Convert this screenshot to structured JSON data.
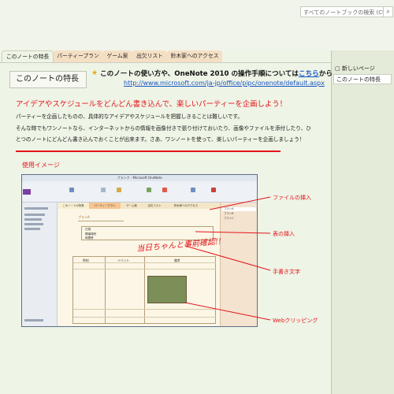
{
  "search": {
    "placeholder": "すべてのノートブックの検索 (Ctrl+E",
    "icon": "search-icon"
  },
  "tabs": [
    {
      "label": "このノートの特長",
      "color": "#eef4e6",
      "active": true
    },
    {
      "label": "パーティープラン",
      "color": "#f5dfc4"
    },
    {
      "label": "ゲーム案",
      "color": "#f5dfc4"
    },
    {
      "label": "出欠リスト",
      "color": "#f5dfc4"
    },
    {
      "label": "鈴木家へのアクセス",
      "color": "#f5dfc4"
    }
  ],
  "side_panel": {
    "new_page": "新しいページ",
    "pages": [
      "このノートの特長"
    ]
  },
  "page": {
    "title": "このノートの特長",
    "headline_before": "このノートの使い方や、OneNote 2010 の操作手順については",
    "headline_link": "こちら",
    "headline_after": "から",
    "url": "http://www.microsoft.com/ja-jp/office/pipc/onenote/default.aspx",
    "catchphrase": "アイデアやスケジュールをどんどん書き込んで、楽しいパーティーを企画しよう！",
    "paragraph_1": "パーティーを企画したものの、具体的なアイデアやスケジュールを把握しきることは難しいです。",
    "paragraph_2": "そんな時でもワンノートなら、インターネットからの情報を画像付きで張り付けておいたり、画像やファイルを添付したり、ひ",
    "paragraph_3": "とつのノートにどんどん書き込んでおくことが出来ます。さあ、ワンノートを使って、楽しいパーティーを企画しましょう！",
    "usage_heading": "使用イメージ"
  },
  "screenshot": {
    "window_title": "ブランク - Microsoft OneNote",
    "tabs": [
      "このノートの特長",
      "パーティープラン",
      "ゲーム案",
      "出欠リスト",
      "鈴木家へのアクセス"
    ],
    "pages": [
      "プランA",
      "プランB",
      "プランC"
    ],
    "page_title": "プランA",
    "row_labels": [
      "日程",
      "開催場所",
      "時間帯"
    ],
    "grid_headers": [
      "時刻",
      "イベント",
      "備考"
    ],
    "handwriting": "当日ちゃんと事前確認!!"
  },
  "callouts": [
    "ファイルの挿入",
    "表の挿入",
    "手書き文字",
    "Webクリッピング"
  ],
  "colors": {
    "accent_red": "#e4141b",
    "link_blue": "#1a56c7",
    "page_bg": "#eef4e6"
  }
}
